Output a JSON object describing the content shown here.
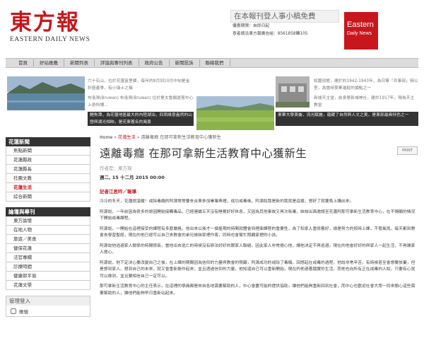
{
  "header": {
    "logo_cn": "東方報",
    "logo_en": "EASTERN DAILY NEWS",
    "ad_title": "在本報刊登人事小稿免費",
    "ad_line1": "優惠期限：自即日起",
    "ad_line2": "意者請洽東方報廣告組：8561858轉105",
    "en_logo_line1": "Eastern",
    "en_logo_line2": "Daily News"
  },
  "nav": {
    "items": [
      "首頁",
      "好站推薦",
      "新聞列表",
      "評論與專刊列表",
      "政府公告",
      "新聞投訴",
      "聯絡我們"
    ]
  },
  "strip": {
    "left_caption": "六十石山，位於花蓮富里鄉，每年的8月到10月中旬是金針盛產季，有小瑞士之稱",
    "left_caption2": "布洛灣(Bruwan) 布洛灣(Bruwan) 位於是太魯閣遊客中心上游所謂...",
    "left_dark": "鯉魚潭，為花蓮地區最大的內陸湖泊，四周綠意盎然的山巒與湖光相映，是花東著名的風景",
    "right_caption": "松園別館，建於約1942-1943年，為日軍「兵事部」辦公室，為當時美軍進駐的據點之一",
    "right_caption2": "新城天主堂，前身是新城神社，建於1917年，現為天主教堂",
    "right_dark": "東華大學美崙，流光賦麗，蘊藏了自然與人文之美，是東部最具特色之一"
  },
  "sidebar": {
    "news_head": "花蓮新聞",
    "news_items": [
      "焦點新聞",
      "花蓮縣政",
      "花蓮縣長",
      "社團文教",
      "花蓮生活",
      "綜合新聞"
    ],
    "opinion_head": "論壇與專刊",
    "opinion_items": [
      "東方論壇",
      "在地人物",
      "旅遊／美食",
      "健保花蓮",
      "法官專欄",
      "診療時間",
      "健康郎平易",
      "花蓮文學"
    ],
    "login_head": "管理登入",
    "login_label": "帳號"
  },
  "article": {
    "crumb_home": "Home",
    "crumb_cat": "花蓮生活",
    "crumb_title": "遠離毒癮 在那可拿新生活教育中心獲新生",
    "title": "遠離毒癮 在那可拿新生活教育中心獲新生",
    "print": "PRINT",
    "author": "作者是：東方報",
    "date": "週二, 15 十二月 2015 00:00",
    "reporter": "記者江思吟／報導",
    "paragraphs": [
      "冷冷的冬天，花蓮很溫暖！戒除毒癮的阿源常常要去台東參加畢業典禮，成功戒毒後，阿源說我是新的我就是這樣，想好了就要馬上講出來。",
      "阿源說，一年前因為很多的原因開始接觸毒品，已經連續五天沒有睡覺好好休息，又因為其他事故又再次吸毒，妹妹出面邀請至花蓮阿那可拿新生活教育中心，在不情願的情況下開始戒毒課程。",
      "阿源說，一開始在這裡接受的課程有多麼嚴格，他出來以後才一個星期的時間就體會到裡面課程的重要性，為了和家人重修舊好，總是努力的按時上課，不管風雨，每天都到教會去學習聖經，現在的他已經可以自己去教會的弟兄姊妹家裡作客，同時也會幫忙照顧家裡的小孩。",
      "阿源說他逃避家人關係的時間很長，當他出去逃亡的時候沒有辦法好好的跟家人聯絡，因此家人非常擔心他，讓他決定不再逃避，現在的他會好好的與家人一起生活，不再讓家人擔心。",
      "阿源說，他下定決心要改變自己之後，在上課的期間因為信仰的力量與教會的照顧，阿源成功的戒除了毒癮。回想起在戒毒的過程，他說非常辛苦，有時候甚至會想要放棄，但是想到家人、想到自己的未來，就又會重新振作起來；並且透過信仰的力量，他知道自己可以重新開始，現在的他過著踏實的生活，而他也向所有正在戒毒的人說，只要有心就可以做到，並且要相信自己一定可以。",
      "那可拿新生活教育中心的主任表示，在這裡的學員都是來自各地需要幫助的人，中心會盡可能的提供協助，讓他們能夠重新回到社會，而中心也歡迎社會大眾一同來關心這些需要幫助的人，讓他們能夠早日重新站起來。"
    ]
  }
}
